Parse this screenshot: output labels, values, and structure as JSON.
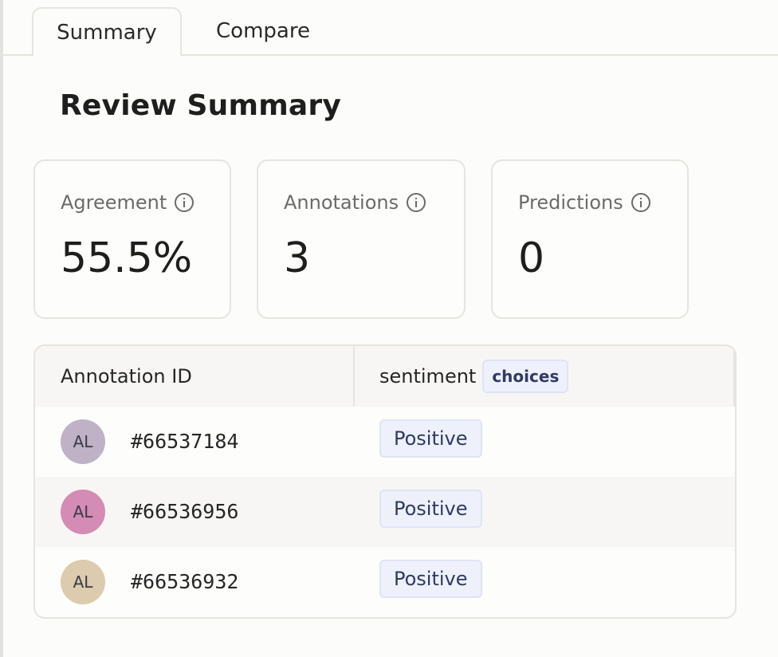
{
  "tabs": [
    {
      "label": "Summary",
      "active": true
    },
    {
      "label": "Compare",
      "active": false
    }
  ],
  "page_title": "Review Summary",
  "stats": [
    {
      "label": "Agreement",
      "value": "55.5%"
    },
    {
      "label": "Annotations",
      "value": "3"
    },
    {
      "label": "Predictions",
      "value": "0"
    }
  ],
  "table": {
    "headers": {
      "annotation_id": "Annotation ID",
      "sentiment": "sentiment",
      "sentiment_badge": "choices"
    },
    "rows": [
      {
        "avatar": "AL",
        "avatar_color": "#bfb1c6",
        "id": "#66537184",
        "sentiment": "Positive"
      },
      {
        "avatar": "AL",
        "avatar_color": "#d48bb5",
        "id": "#66536956",
        "sentiment": "Positive"
      },
      {
        "avatar": "AL",
        "avatar_color": "#dccbae",
        "id": "#66536932",
        "sentiment": "Positive"
      }
    ]
  },
  "colors": {
    "tag_bg": "#eef1fb",
    "tag_text": "#2f3a63",
    "border": "#e6e4de"
  },
  "icons": {
    "info": "info-icon"
  }
}
